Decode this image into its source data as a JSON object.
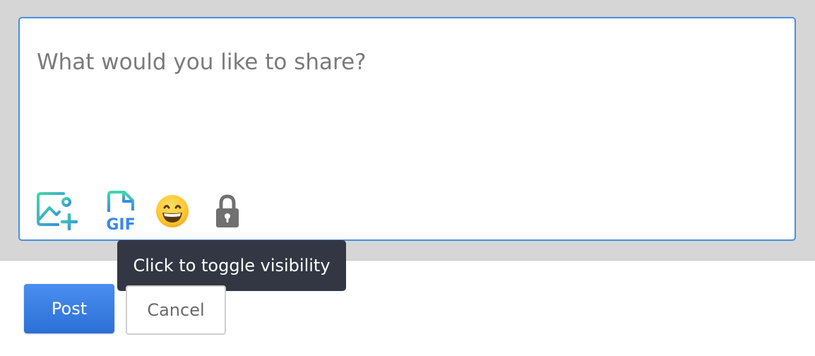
{
  "composer": {
    "placeholder": "What would you like to share?",
    "value": ""
  },
  "toolbar": {
    "items": [
      {
        "icon": "image-add-icon"
      },
      {
        "icon": "gif-icon",
        "label": "GIF"
      },
      {
        "icon": "emoji-icon",
        "label": "😄"
      },
      {
        "icon": "lock-icon"
      }
    ]
  },
  "tooltip": {
    "text": "Click to toggle visibility"
  },
  "actions": {
    "post_label": "Post",
    "cancel_label": "Cancel"
  },
  "colors": {
    "accent": "#2b70d6",
    "focus_border": "#4a8ee0",
    "icon_teal": "#35d0b5",
    "icon_blue": "#3a88e6",
    "tooltip_bg": "#333743",
    "panel_bg": "#d6d6d6"
  }
}
